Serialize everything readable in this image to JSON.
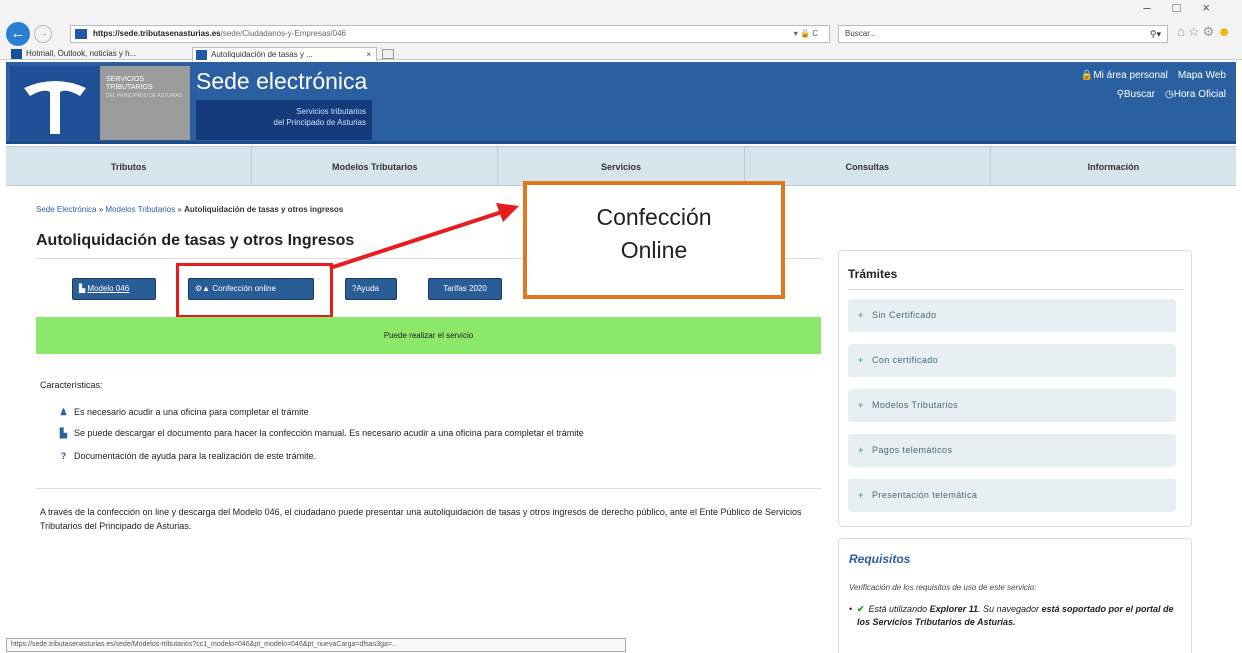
{
  "browser": {
    "url": "https://sede.tributasenasturias.es/sede/Ciudadanos-y-Empresas/046",
    "url_domain": "https://sede.tributasenasturias.es",
    "url_path": "/sede/Ciudadanos-y-Empresas/046",
    "address_tools": "▾ 🔒 C",
    "search_placeholder": "Buscar...",
    "search_icon": "search-icon",
    "tabs": [
      {
        "label": "Hotmail, Outlook, noticias y h..."
      },
      {
        "label": "Autoliquidación de tasas y ..."
      }
    ],
    "tab_close": "×",
    "status_url": "https://sede.tributasenasturias.es/sede/Modelos-tributarios?cc1_modelo=046&pt_modelo=046&pt_nuevaCarga=dfsas3ga=..."
  },
  "header": {
    "logo_text": "SERVICIOS TRIBUTARIOS",
    "logo_small": "DEL PRINCIPADO DE ASTURIAS",
    "site_title": "Sede electrónica",
    "subtitle_line1": "Servicios tributarios",
    "subtitle_line2": "del Principado de Asturias",
    "mi_area": "Mi área personal",
    "mapa_web": "Mapa Web",
    "buscar": "Buscar",
    "hora_oficial": "Hora Oficial"
  },
  "menu": [
    "Tributos",
    "Modelos Tributarios",
    "Servicios",
    "Consultas",
    "Información"
  ],
  "breadcrumb": {
    "home": "Sede Electrónica",
    "sep1": " » ",
    "section": "Modelos Tributarios",
    "sep2": "  » ",
    "current": "Autoliquidación de tasas y otros ingresos"
  },
  "page_title": "Autoliquidación de tasas y otros Ingresos",
  "buttons": {
    "modelo": "Modelo 046",
    "confeccion": "Confección online",
    "ayuda": "Ayuda",
    "tarifas": "Tarifas 2020"
  },
  "callout": {
    "line1": "Confección",
    "line2": "Online"
  },
  "status_message": "Puede realizar el servicio",
  "caracteristicas": {
    "heading": "Características:",
    "items": [
      {
        "icon": "person-icon",
        "text": "Es necesario acudir a una oficina para completar el trámite"
      },
      {
        "icon": "document-icon",
        "text": "Se puede descargar el documento para hacer la confección manual. Es necesario acudir a una oficina para completar el trámite"
      },
      {
        "icon": "question-icon",
        "text": "Documentación de ayuda para la realización de este trámite."
      }
    ]
  },
  "description": "A través de la confección on line y descarga del Modelo 046, el ciudadano puede presentar una autoliquidación de tasas y otros ingresos de derecho público, ante el Ente Público de Servicios Tributarios del Principado de Asturias.",
  "tramites": {
    "title": "Trámites",
    "items": [
      "Sin Certificado",
      "Con certificado",
      "Modelos Tributarios",
      "Pagos telemáticos",
      "Presentación telemática"
    ]
  },
  "requisitos": {
    "title": "Requisitos",
    "subtitle": "Verificación de los requisitos de uso de este servicio:",
    "item_pre": "Está utilizando ",
    "item_browser": "Explorer 11",
    "item_mid": ". Su navegador ",
    "item_bold": "está soportado por el portal de los Servicios Tributarios de Asturias."
  },
  "colors": {
    "header_blue": "#2a5fa2",
    "highlight_red": "#e81c1c",
    "callout_orange": "#e0781d",
    "status_green": "#8ce868"
  }
}
